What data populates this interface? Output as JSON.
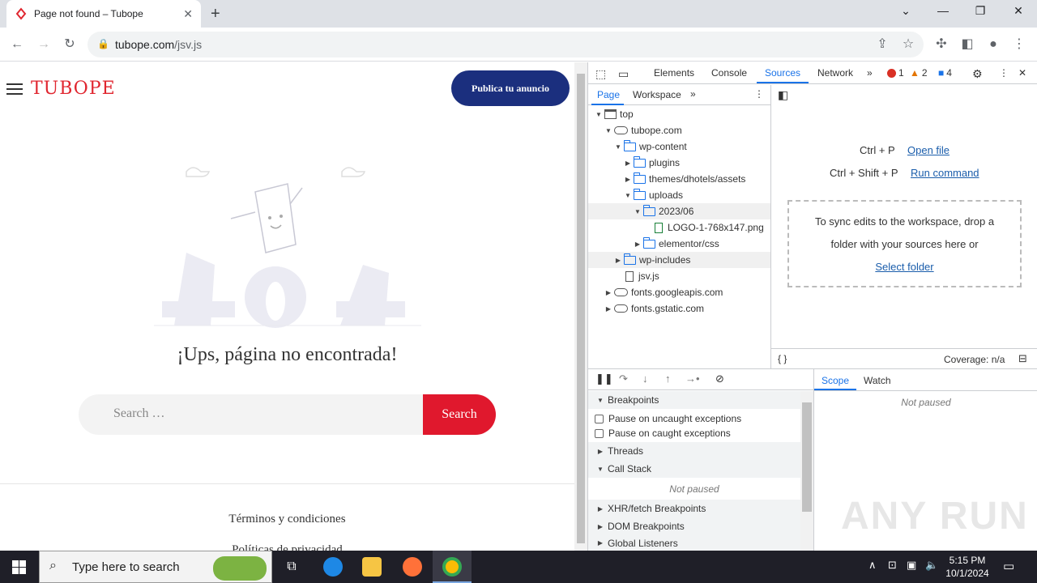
{
  "browser": {
    "tab_title": "Page not found – Tubope",
    "url_host": "tubope.com",
    "url_path": "/jsv.js"
  },
  "page": {
    "logo_text": "TUBOPE",
    "publica_label": "Publica tu anuncio",
    "heading": "¡Ups, página no encontrada!",
    "search_placeholder": "Search …",
    "search_button": "Search",
    "footer_link_1": "Términos y condiciones",
    "footer_link_2": "Políticas de privacidad"
  },
  "devtools": {
    "tabs": [
      "Elements",
      "Console",
      "Sources",
      "Network"
    ],
    "active_tab": "Sources",
    "errors": "1",
    "warnings": "2",
    "messages": "4",
    "nav_tabs": [
      "Page",
      "Workspace"
    ],
    "tree": [
      {
        "label": "top",
        "kind": "frame",
        "depth": 0,
        "arrow": "down"
      },
      {
        "label": "tubope.com",
        "kind": "cloud",
        "depth": 1,
        "arrow": "down"
      },
      {
        "label": "wp-content",
        "kind": "folder",
        "depth": 2,
        "arrow": "down"
      },
      {
        "label": "plugins",
        "kind": "folder",
        "depth": 3,
        "arrow": "right"
      },
      {
        "label": "themes/dhotels/assets",
        "kind": "folder",
        "depth": 3,
        "arrow": "right"
      },
      {
        "label": "uploads",
        "kind": "folder",
        "depth": 3,
        "arrow": "down"
      },
      {
        "label": "2023/06",
        "kind": "folder",
        "depth": 4,
        "arrow": "down",
        "selected": true
      },
      {
        "label": "LOGO-1-768x147.png",
        "kind": "image",
        "depth": 5,
        "arrow": ""
      },
      {
        "label": "elementor/css",
        "kind": "folder",
        "depth": 4,
        "arrow": "right"
      },
      {
        "label": "wp-includes",
        "kind": "folder",
        "depth": 2,
        "arrow": "right",
        "selected": true
      },
      {
        "label": "jsv.js",
        "kind": "file",
        "depth": 2,
        "arrow": ""
      },
      {
        "label": "fonts.googleapis.com",
        "kind": "cloud",
        "depth": 1,
        "arrow": "right"
      },
      {
        "label": "fonts.gstatic.com",
        "kind": "cloud",
        "depth": 1,
        "arrow": "right"
      }
    ],
    "shortcut_1_keys": "Ctrl + P",
    "shortcut_1_action": "Open file",
    "shortcut_2_keys": "Ctrl + Shift + P",
    "shortcut_2_action": "Run command",
    "drop_line_1": "To sync edits to the workspace, drop a",
    "drop_line_2": "folder with your sources here or",
    "drop_link": "Select folder",
    "coverage": "Coverage: n/a",
    "right_tabs": [
      "Scope",
      "Watch"
    ],
    "not_paused": "Not paused",
    "sections": {
      "breakpoints": "Breakpoints",
      "pause_uncaught": "Pause on uncaught exceptions",
      "pause_caught": "Pause on caught exceptions",
      "threads": "Threads",
      "call_stack": "Call Stack",
      "xhr": "XHR/fetch Breakpoints",
      "dom": "DOM Breakpoints",
      "global": "Global Listeners"
    }
  },
  "watermark": "ANY RUN",
  "taskbar": {
    "search_placeholder": "Type here to search",
    "time": "5:15 PM",
    "date": "10/1/2024"
  }
}
